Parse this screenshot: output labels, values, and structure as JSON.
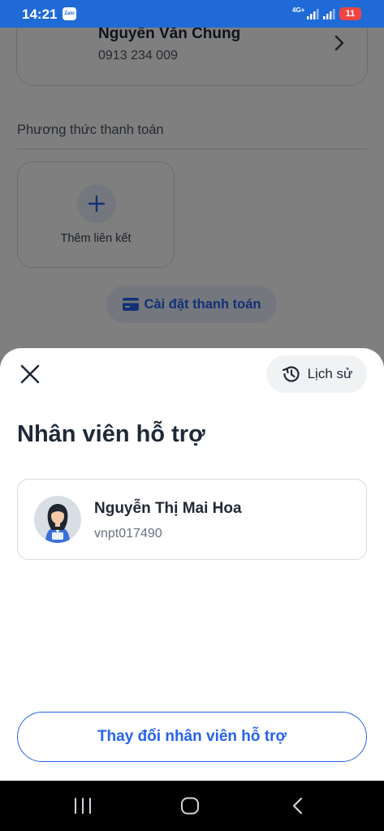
{
  "status_bar": {
    "time": "14:21",
    "notification_app": "Zalo",
    "network": "4G+",
    "battery": "11"
  },
  "background": {
    "customer": {
      "name": "Nguyễn Văn Chung",
      "phone": "0913 234 009"
    },
    "payment_methods_title": "Phương thức thanh toán",
    "add_link_label": "Thêm liên kết",
    "payment_settings_label": "Cài đặt thanh toán"
  },
  "sheet": {
    "history_label": "Lịch sử",
    "title": "Nhân viên hỗ trợ",
    "staff": {
      "name": "Nguyễn Thị Mai Hoa",
      "id": "vnpt017490"
    },
    "change_button_label": "Thay đổi nhân viên hỗ trợ"
  },
  "colors": {
    "primary": "#2563eb",
    "status_bar": "#1f6ad6",
    "battery_low": "#ef4444"
  },
  "icons": [
    "close-icon",
    "history-icon",
    "plus-icon",
    "card-icon",
    "chevron-right-icon",
    "recent-apps-icon",
    "home-icon",
    "back-icon"
  ]
}
